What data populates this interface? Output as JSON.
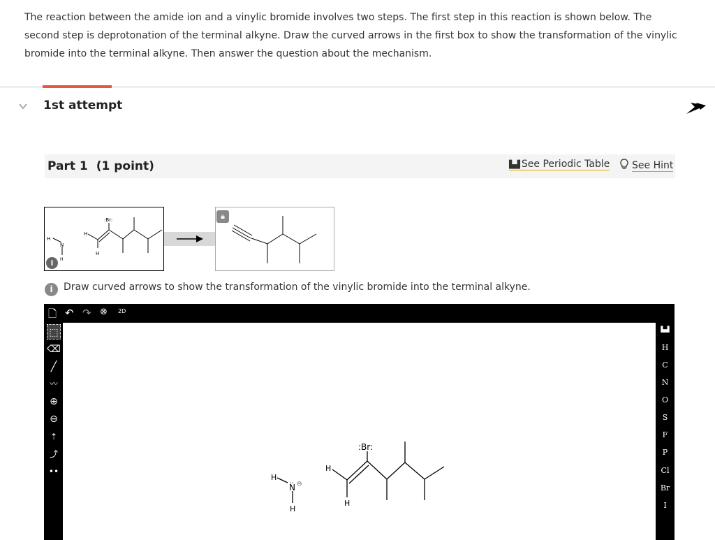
{
  "question": {
    "text": "The reaction between the amide ion and a vinylic bromide involves two steps. The first step in this reaction is shown below. The second step is deprotonation of the terminal alkyne. Draw the curved arrows in the first box to show the transformation of the vinylic bromide into the terminal alkyne. Then answer the question about the mechanism."
  },
  "attempt": {
    "label": "1st attempt"
  },
  "part": {
    "title": "Part 1",
    "points": "(1 point)",
    "periodic_label": "See Periodic Table",
    "hint_label": "See Hint"
  },
  "instruction": "Draw curved arrows to show the transformation of the vinylic bromide into the terminal alkyne.",
  "editor": {
    "toolbar_top_icons": [
      "new-document-icon",
      "undo-icon",
      "redo-icon",
      "zoom-fit-icon",
      "2d-clean-icon"
    ],
    "clean_label": "2D",
    "left_tools": [
      "select-tool-icon",
      "eraser-icon",
      "bond-tool-icon",
      "chain-tool-icon",
      "positive-charge-icon",
      "negative-charge-icon",
      "charge-arrow-icon",
      "curved-arrow-icon",
      "lone-pair-icon"
    ],
    "elements": [
      "H",
      "C",
      "N",
      "O",
      "S",
      "F",
      "P",
      "Cl",
      "Br",
      "I"
    ]
  },
  "molecules": {
    "bromine": ":Br:",
    "nitrogen": "N",
    "hydrogen": "H",
    "charge": "⊖"
  },
  "colors": {
    "accent": "#e55a3d",
    "link_underline": "#e2a800",
    "editor_bg": "#000000"
  }
}
